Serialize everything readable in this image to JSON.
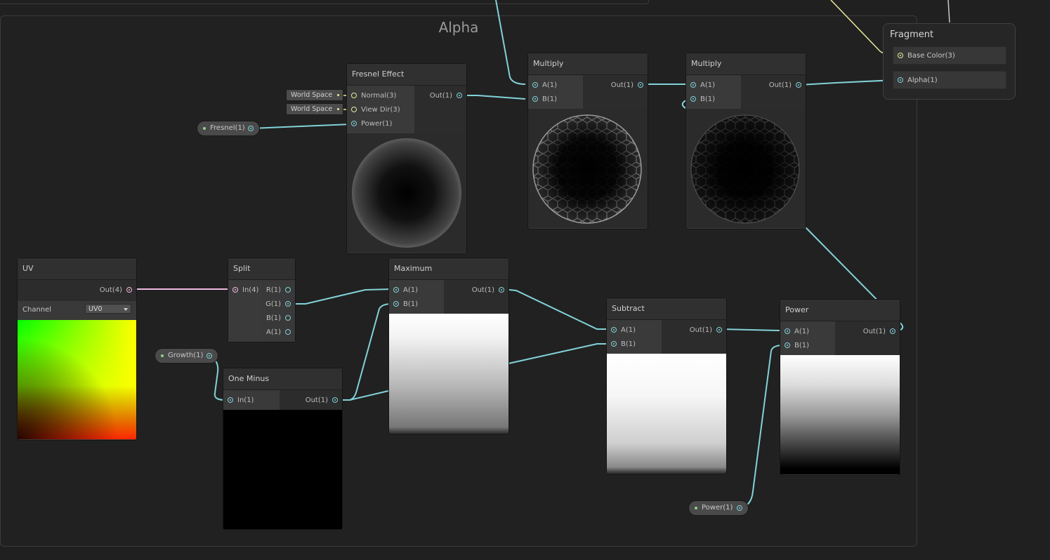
{
  "group": {
    "title": "Alpha"
  },
  "fragment": {
    "title": "Fragment",
    "slots": [
      "Base Color(3)",
      "Alpha(1)"
    ]
  },
  "fresnel": {
    "title": "Fresnel Effect",
    "inputs": [
      "Normal(3)",
      "View Dir(3)",
      "Power(1)"
    ],
    "output": "Out(1)",
    "tags": [
      "World Space",
      "World Space"
    ]
  },
  "multiply1": {
    "title": "Multiply",
    "inputs": [
      "A(1)",
      "B(1)"
    ],
    "output": "Out(1)"
  },
  "multiply2": {
    "title": "Multiply",
    "inputs": [
      "A(1)",
      "B(1)"
    ],
    "output": "Out(1)"
  },
  "uv": {
    "title": "UV",
    "output": "Out(4)",
    "channel_label": "Channel",
    "channel_value": "UV0"
  },
  "split": {
    "title": "Split",
    "input": "In(4)",
    "outputs": [
      "R(1)",
      "G(1)",
      "B(1)",
      "A(1)"
    ]
  },
  "maximum": {
    "title": "Maximum",
    "inputs": [
      "A(1)",
      "B(1)"
    ],
    "output": "Out(1)"
  },
  "one_minus": {
    "title": "One Minus",
    "input": "In(1)",
    "output": "Out(1)"
  },
  "subtract": {
    "title": "Subtract",
    "inputs": [
      "A(1)",
      "B(1)"
    ],
    "output": "Out(1)"
  },
  "power": {
    "title": "Power",
    "inputs": [
      "A(1)",
      "B(1)"
    ],
    "output": "Out(1)"
  },
  "properties": {
    "fresnel": "Fresnel(1)",
    "growth": "Growth(1)",
    "power": "Power(1)"
  },
  "colors": {
    "wire_float": "#82d2d8",
    "wire_vector4": "#f0b8e0",
    "wire_vector3": "#eaea9c",
    "property_dot": "#8fd18b"
  }
}
